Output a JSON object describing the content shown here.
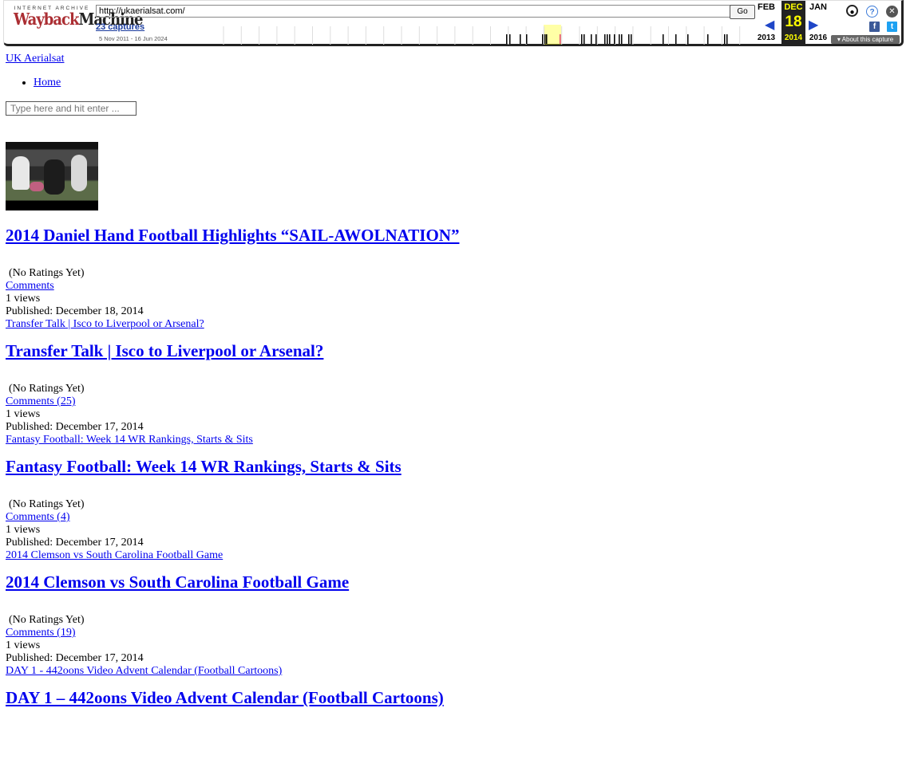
{
  "wayback": {
    "logo_top": "INTERNET ARCHIVE",
    "logo_a": "Wayback",
    "logo_b": "Machine",
    "url": "http://ukaerialsat.com/",
    "go_label": "Go",
    "captures": "23 captures",
    "range": "5 Nov 2011 - 16 Jun 2024",
    "prev_month": "FEB",
    "prev_year": "2013",
    "cur_month": "DEC",
    "cur_day": "18",
    "cur_year": "2014",
    "next_month": "JAN",
    "next_year": "2016",
    "about": "About this capture",
    "colors": {
      "highlight": "#ffff00",
      "capture_bar": "#000000",
      "current_capture": "#e04070"
    }
  },
  "site": {
    "logo_alt": "UK Aerialsat",
    "nav": [
      "Home"
    ],
    "search_placeholder": "Type here and hit enter ..."
  },
  "posts": [
    {
      "thumb_alt": "",
      "title": "2014 Daniel Hand Football Highlights “SAIL-AWOLNATION”",
      "rating": "(No Ratings Yet)",
      "comments": "Comments",
      "views": "1 views",
      "published": "Published: December 18, 2014"
    },
    {
      "thumb_alt": "Transfer Talk | Isco to Liverpool or Arsenal?",
      "title": "Transfer Talk | Isco to Liverpool or Arsenal?",
      "rating": "(No Ratings Yet)",
      "comments": "Comments (25)",
      "views": "1 views",
      "published": "Published: December 17, 2014"
    },
    {
      "thumb_alt": "Fantasy Football: Week 14 WR Rankings, Starts & Sits",
      "title": "Fantasy Football: Week 14 WR Rankings, Starts & Sits",
      "rating": "(No Ratings Yet)",
      "comments": "Comments (4)",
      "views": "1 views",
      "published": "Published: December 17, 2014"
    },
    {
      "thumb_alt": "2014 Clemson vs South Carolina Football Game",
      "title": "2014 Clemson vs South Carolina Football Game",
      "rating": "(No Ratings Yet)",
      "comments": "Comments (19)",
      "views": "1 views",
      "published": "Published: December 17, 2014"
    },
    {
      "thumb_alt": "DAY 1 - 442oons Video Advent Calendar (Football Cartoons)",
      "title": "DAY 1 – 442oons Video Advent Calendar (Football Cartoons)"
    }
  ]
}
